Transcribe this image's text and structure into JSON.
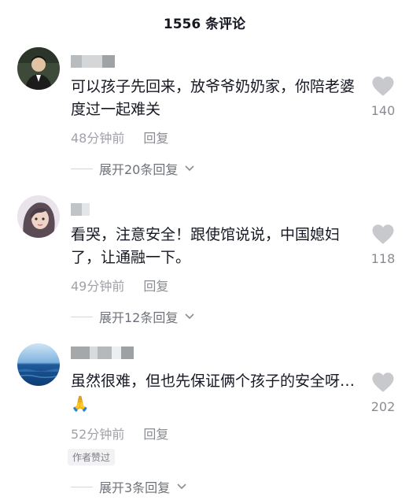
{
  "header": {
    "title": "1556 条评论"
  },
  "comments": [
    {
      "text": "可以孩子先回来，放爷爷奶奶家，你陪老婆度过一起难关",
      "time": "48分钟前",
      "reply": "回复",
      "likes": "140",
      "expand": "展开20条回复",
      "avatar_icon": "person-avatar-icon"
    },
    {
      "text": "看哭，注意安全！跟使馆说说，中国媳妇了，让通融一下。",
      "time": "49分钟前",
      "reply": "回复",
      "likes": "118",
      "expand": "展开12条回复",
      "avatar_icon": "woman-avatar-icon"
    },
    {
      "text": "虽然很难，但也先保证俩个孩子的安全呀…🙏",
      "time": "52分钟前",
      "reply": "回复",
      "likes": "202",
      "badge": "作者赞过",
      "expand": "展开3条回复",
      "avatar_icon": "ocean-avatar-icon"
    }
  ],
  "colors": {
    "text": "#161823",
    "meta": "#a0a2a8",
    "heart": "#c8c9cd"
  }
}
